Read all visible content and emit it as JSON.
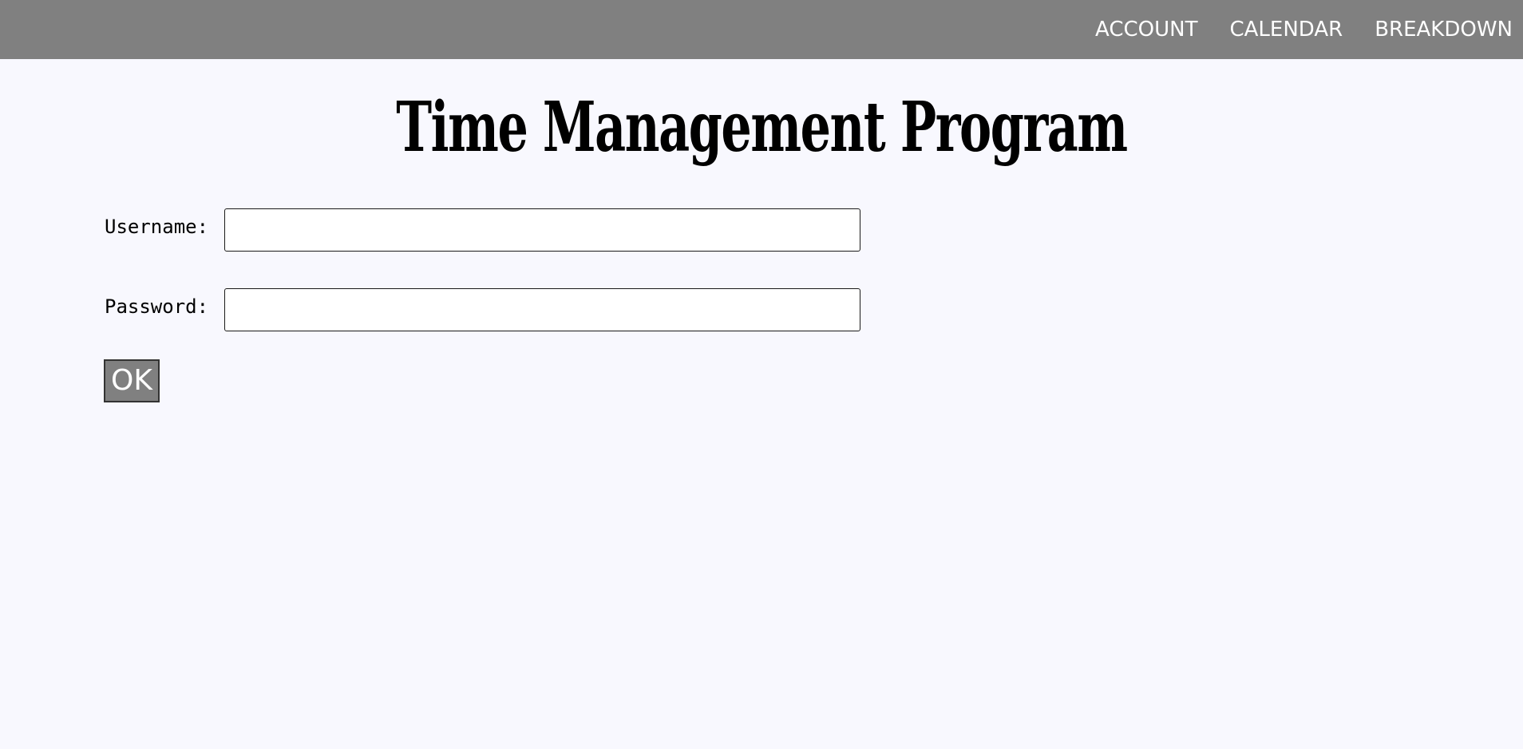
{
  "nav": {
    "items": [
      {
        "label": "ACCOUNT"
      },
      {
        "label": "CALENDAR"
      },
      {
        "label": "BREAKDOWN"
      }
    ]
  },
  "page": {
    "title": "Time Management Program"
  },
  "form": {
    "username_label": "Username:",
    "username_value": "",
    "password_label": "Password:",
    "password_value": "",
    "ok_label": "OK"
  },
  "colors": {
    "topbar": "#808080",
    "background": "#f8f8fe",
    "button": "#808080",
    "nav_text": "#ffffff"
  }
}
